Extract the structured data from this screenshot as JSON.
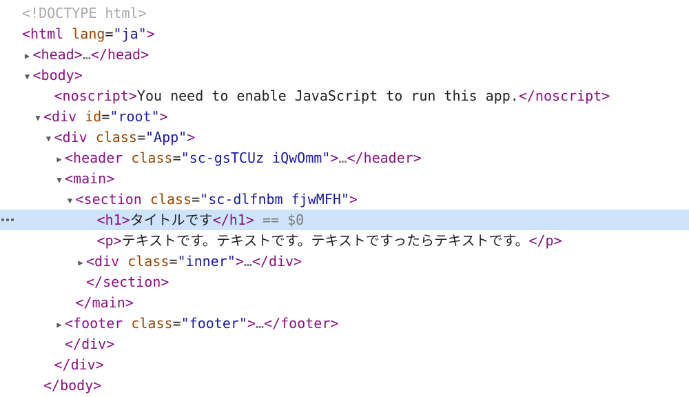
{
  "panel": {
    "name": "elements-dom-tree",
    "theme": {
      "background": "#ffffff",
      "selection": "#cfe4fb",
      "tag_color": "#881280",
      "attr_name_color": "#994500",
      "attr_value_color": "#1a1aa6",
      "text_color": "#222222",
      "doctype_color": "#a9a9a9",
      "muted_color": "#6e6e6e"
    },
    "selected_node_ref": "== $0",
    "more_badge": "ellipsis-badge"
  },
  "rows": [
    {
      "id": "doctype",
      "twisty": "",
      "indent": 0,
      "selected": false,
      "segments": [
        {
          "cls": "doctype",
          "t": "<!DOCTYPE html>"
        }
      ]
    },
    {
      "id": "html-open",
      "twisty": "",
      "indent": 0,
      "selected": false,
      "segments": [
        {
          "cls": "punct",
          "t": "<"
        },
        {
          "cls": "tag",
          "t": "html"
        },
        {
          "cls": "text",
          "t": " "
        },
        {
          "cls": "attr",
          "t": "lang"
        },
        {
          "cls": "text",
          "t": "="
        },
        {
          "cls": "val",
          "t": "\"ja\""
        },
        {
          "cls": "punct",
          "t": ">"
        }
      ]
    },
    {
      "id": "head-collapsed",
      "twisty": "collapsed",
      "indent": 1,
      "selected": false,
      "segments": [
        {
          "cls": "punct",
          "t": "<"
        },
        {
          "cls": "tag",
          "t": "head"
        },
        {
          "cls": "punct",
          "t": ">"
        },
        {
          "cls": "ellipsis",
          "t": "…"
        },
        {
          "cls": "punct",
          "t": "</"
        },
        {
          "cls": "tag",
          "t": "head"
        },
        {
          "cls": "punct",
          "t": ">"
        }
      ]
    },
    {
      "id": "body-open",
      "twisty": "expanded",
      "indent": 1,
      "selected": false,
      "segments": [
        {
          "cls": "punct",
          "t": "<"
        },
        {
          "cls": "tag",
          "t": "body"
        },
        {
          "cls": "punct",
          "t": ">"
        }
      ]
    },
    {
      "id": "noscript",
      "twisty": "",
      "indent": 3,
      "selected": false,
      "segments": [
        {
          "cls": "punct",
          "t": "<"
        },
        {
          "cls": "tag",
          "t": "noscript"
        },
        {
          "cls": "punct",
          "t": ">"
        },
        {
          "cls": "text",
          "t": "You need to enable JavaScript to run this app."
        },
        {
          "cls": "punct",
          "t": "</"
        },
        {
          "cls": "tag",
          "t": "noscript"
        },
        {
          "cls": "punct",
          "t": ">"
        }
      ]
    },
    {
      "id": "div-root",
      "twisty": "expanded",
      "indent": 2,
      "selected": false,
      "segments": [
        {
          "cls": "punct",
          "t": "<"
        },
        {
          "cls": "tag",
          "t": "div"
        },
        {
          "cls": "text",
          "t": " "
        },
        {
          "cls": "attr",
          "t": "id"
        },
        {
          "cls": "text",
          "t": "="
        },
        {
          "cls": "val",
          "t": "\"root\""
        },
        {
          "cls": "punct",
          "t": ">"
        }
      ]
    },
    {
      "id": "div-app",
      "twisty": "expanded",
      "indent": 3,
      "selected": false,
      "segments": [
        {
          "cls": "punct",
          "t": "<"
        },
        {
          "cls": "tag",
          "t": "div"
        },
        {
          "cls": "text",
          "t": " "
        },
        {
          "cls": "attr",
          "t": "class"
        },
        {
          "cls": "text",
          "t": "="
        },
        {
          "cls": "val",
          "t": "\"App\""
        },
        {
          "cls": "punct",
          "t": ">"
        }
      ]
    },
    {
      "id": "header-collapsed",
      "twisty": "collapsed",
      "indent": 4,
      "selected": false,
      "segments": [
        {
          "cls": "punct",
          "t": "<"
        },
        {
          "cls": "tag",
          "t": "header"
        },
        {
          "cls": "text",
          "t": " "
        },
        {
          "cls": "attr",
          "t": "class"
        },
        {
          "cls": "text",
          "t": "="
        },
        {
          "cls": "val",
          "t": "\"sc-gsTCUz iQwOmm\""
        },
        {
          "cls": "punct",
          "t": ">"
        },
        {
          "cls": "ellipsis",
          "t": "…"
        },
        {
          "cls": "punct",
          "t": "</"
        },
        {
          "cls": "tag",
          "t": "header"
        },
        {
          "cls": "punct",
          "t": ">"
        }
      ]
    },
    {
      "id": "main-open",
      "twisty": "expanded",
      "indent": 4,
      "selected": false,
      "segments": [
        {
          "cls": "punct",
          "t": "<"
        },
        {
          "cls": "tag",
          "t": "main"
        },
        {
          "cls": "punct",
          "t": ">"
        }
      ]
    },
    {
      "id": "section-open",
      "twisty": "expanded",
      "indent": 5,
      "selected": false,
      "segments": [
        {
          "cls": "punct",
          "t": "<"
        },
        {
          "cls": "tag",
          "t": "section"
        },
        {
          "cls": "text",
          "t": " "
        },
        {
          "cls": "attr",
          "t": "class"
        },
        {
          "cls": "text",
          "t": "="
        },
        {
          "cls": "val",
          "t": "\"sc-dlfnbm fjwMFH\""
        },
        {
          "cls": "punct",
          "t": ">"
        }
      ]
    },
    {
      "id": "h1-selected",
      "twisty": "",
      "indent": 7,
      "selected": true,
      "segments": [
        {
          "cls": "punct",
          "t": "<"
        },
        {
          "cls": "tag",
          "t": "h1"
        },
        {
          "cls": "punct",
          "t": ">"
        },
        {
          "cls": "text",
          "t": "タイトルです"
        },
        {
          "cls": "punct",
          "t": "</"
        },
        {
          "cls": "tag",
          "t": "h1"
        },
        {
          "cls": "punct",
          "t": ">"
        },
        {
          "cls": "eqsel",
          "t": " == "
        },
        {
          "cls": "eqsel dollar",
          "t": "$0"
        }
      ]
    },
    {
      "id": "p-text",
      "twisty": "",
      "indent": 7,
      "selected": false,
      "segments": [
        {
          "cls": "punct",
          "t": "<"
        },
        {
          "cls": "tag",
          "t": "p"
        },
        {
          "cls": "punct",
          "t": ">"
        },
        {
          "cls": "text",
          "t": "テキストです。テキストです。テキストですったらテキストです。"
        },
        {
          "cls": "punct",
          "t": "</"
        },
        {
          "cls": "tag",
          "t": "p"
        },
        {
          "cls": "punct",
          "t": ">"
        }
      ]
    },
    {
      "id": "div-inner",
      "twisty": "collapsed",
      "indent": 6,
      "selected": false,
      "segments": [
        {
          "cls": "punct",
          "t": "<"
        },
        {
          "cls": "tag",
          "t": "div"
        },
        {
          "cls": "text",
          "t": " "
        },
        {
          "cls": "attr",
          "t": "class"
        },
        {
          "cls": "text",
          "t": "="
        },
        {
          "cls": "val",
          "t": "\"inner\""
        },
        {
          "cls": "punct",
          "t": ">"
        },
        {
          "cls": "ellipsis",
          "t": "…"
        },
        {
          "cls": "punct",
          "t": "</"
        },
        {
          "cls": "tag",
          "t": "div"
        },
        {
          "cls": "punct",
          "t": ">"
        }
      ]
    },
    {
      "id": "section-close",
      "twisty": "",
      "indent": 6,
      "selected": false,
      "segments": [
        {
          "cls": "punct",
          "t": "</"
        },
        {
          "cls": "tag",
          "t": "section"
        },
        {
          "cls": "punct",
          "t": ">"
        }
      ]
    },
    {
      "id": "main-close",
      "twisty": "",
      "indent": 5,
      "selected": false,
      "segments": [
        {
          "cls": "punct",
          "t": "</"
        },
        {
          "cls": "tag",
          "t": "main"
        },
        {
          "cls": "punct",
          "t": ">"
        }
      ]
    },
    {
      "id": "footer-collapsed",
      "twisty": "collapsed",
      "indent": 4,
      "selected": false,
      "segments": [
        {
          "cls": "punct",
          "t": "<"
        },
        {
          "cls": "tag",
          "t": "footer"
        },
        {
          "cls": "text",
          "t": " "
        },
        {
          "cls": "attr",
          "t": "class"
        },
        {
          "cls": "text",
          "t": "="
        },
        {
          "cls": "val",
          "t": "\"footer\""
        },
        {
          "cls": "punct",
          "t": ">"
        },
        {
          "cls": "ellipsis",
          "t": "…"
        },
        {
          "cls": "punct",
          "t": "</"
        },
        {
          "cls": "tag",
          "t": "footer"
        },
        {
          "cls": "punct",
          "t": ">"
        }
      ]
    },
    {
      "id": "div-app-close",
      "twisty": "",
      "indent": 4,
      "selected": false,
      "segments": [
        {
          "cls": "punct",
          "t": "</"
        },
        {
          "cls": "tag",
          "t": "div"
        },
        {
          "cls": "punct",
          "t": ">"
        }
      ]
    },
    {
      "id": "div-root-close",
      "twisty": "",
      "indent": 3,
      "selected": false,
      "segments": [
        {
          "cls": "punct",
          "t": "</"
        },
        {
          "cls": "tag",
          "t": "div"
        },
        {
          "cls": "punct",
          "t": ">"
        }
      ]
    },
    {
      "id": "body-close-partial",
      "twisty": "",
      "indent": 2,
      "selected": false,
      "segments": [
        {
          "cls": "punct",
          "t": "</"
        },
        {
          "cls": "tag",
          "t": "body"
        },
        {
          "cls": "punct",
          "t": ">"
        }
      ]
    }
  ]
}
